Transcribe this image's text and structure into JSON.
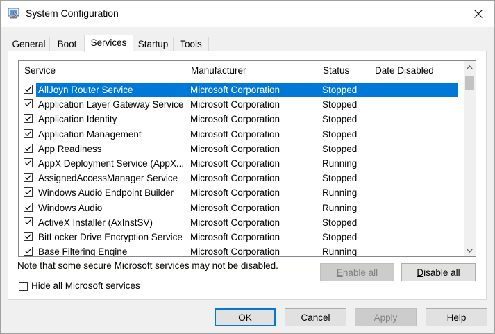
{
  "window": {
    "title": "System Configuration"
  },
  "tabs": [
    {
      "label": "General"
    },
    {
      "label": "Boot"
    },
    {
      "label": "Services"
    },
    {
      "label": "Startup"
    },
    {
      "label": "Tools"
    }
  ],
  "columns": {
    "service": "Service",
    "manufacturer": "Manufacturer",
    "status": "Status",
    "date_disabled": "Date Disabled"
  },
  "services": [
    {
      "name": "AllJoyn Router Service",
      "manufacturer": "Microsoft Corporation",
      "status": "Stopped",
      "date_disabled": "",
      "checked": true,
      "selected": true
    },
    {
      "name": "Application Layer Gateway Service",
      "manufacturer": "Microsoft Corporation",
      "status": "Stopped",
      "date_disabled": "",
      "checked": true
    },
    {
      "name": "Application Identity",
      "manufacturer": "Microsoft Corporation",
      "status": "Stopped",
      "date_disabled": "",
      "checked": true
    },
    {
      "name": "Application Management",
      "manufacturer": "Microsoft Corporation",
      "status": "Stopped",
      "date_disabled": "",
      "checked": true
    },
    {
      "name": "App Readiness",
      "manufacturer": "Microsoft Corporation",
      "status": "Stopped",
      "date_disabled": "",
      "checked": true
    },
    {
      "name": "AppX Deployment Service (AppX...",
      "manufacturer": "Microsoft Corporation",
      "status": "Running",
      "date_disabled": "",
      "checked": true
    },
    {
      "name": "AssignedAccessManager Service",
      "manufacturer": "Microsoft Corporation",
      "status": "Stopped",
      "date_disabled": "",
      "checked": true
    },
    {
      "name": "Windows Audio Endpoint Builder",
      "manufacturer": "Microsoft Corporation",
      "status": "Running",
      "date_disabled": "",
      "checked": true
    },
    {
      "name": "Windows Audio",
      "manufacturer": "Microsoft Corporation",
      "status": "Running",
      "date_disabled": "",
      "checked": true
    },
    {
      "name": "ActiveX Installer (AxInstSV)",
      "manufacturer": "Microsoft Corporation",
      "status": "Stopped",
      "date_disabled": "",
      "checked": true
    },
    {
      "name": "BitLocker Drive Encryption Service",
      "manufacturer": "Microsoft Corporation",
      "status": "Stopped",
      "date_disabled": "",
      "checked": true
    },
    {
      "name": "Base Filtering Engine",
      "manufacturer": "Microsoft Corporation",
      "status": "Running",
      "date_disabled": "",
      "checked": true
    }
  ],
  "note": "Note that some secure Microsoft services may not be disabled.",
  "panel_buttons": {
    "enable_all": {
      "accel": "E",
      "rest": "nable all",
      "disabled": true
    },
    "disable_all": {
      "accel": "D",
      "rest": "isable all",
      "disabled": false
    }
  },
  "hide_ms": {
    "accel": "H",
    "rest": "ide all Microsoft services",
    "checked": false
  },
  "footer": {
    "ok": "OK",
    "cancel": "Cancel",
    "apply": {
      "accel": "A",
      "rest": "pply",
      "disabled": true
    },
    "help": "Help"
  },
  "icons": {
    "app": "system-config-icon",
    "close": "close-icon",
    "check": "check-icon",
    "scroll_up": "chevron-up-icon",
    "scroll_down": "chevron-down-icon"
  },
  "colors": {
    "selection": "#0078d7",
    "window_bg": "#f0f0f0",
    "disabled_text": "#838383"
  }
}
